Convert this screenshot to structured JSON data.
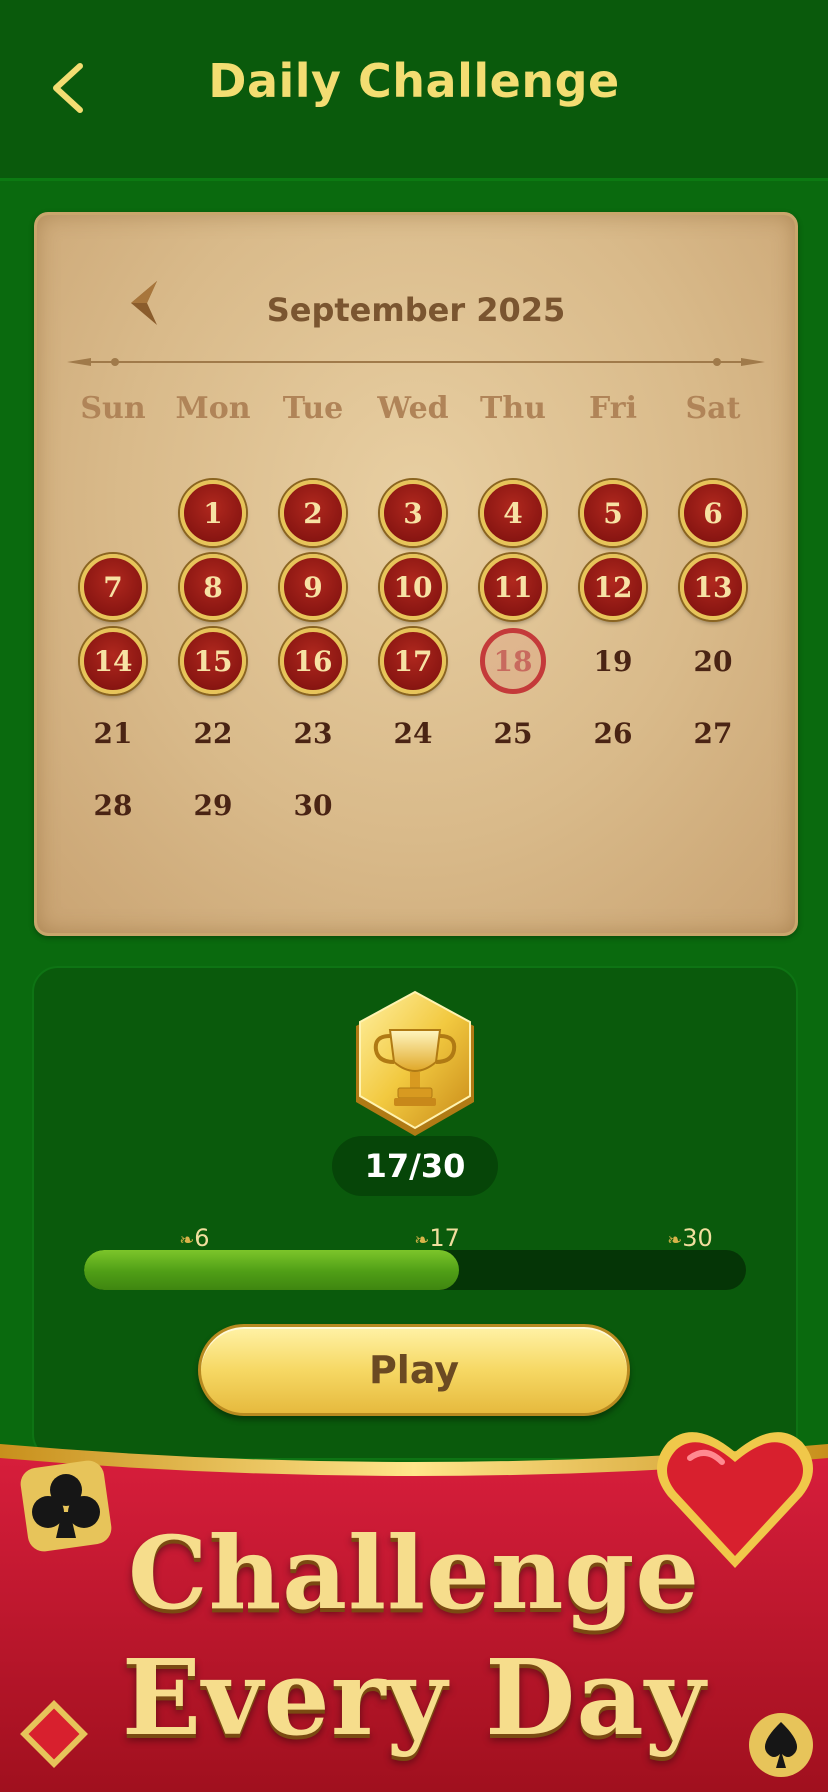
{
  "header": {
    "title": "Daily Challenge",
    "back_icon": "chevron-left-icon"
  },
  "calendar": {
    "month": "September 2025",
    "prev_icon": "arrow-left-icon",
    "weekdays": [
      "Sun",
      "Mon",
      "Tue",
      "Wed",
      "Thu",
      "Fri",
      "Sat"
    ],
    "first_weekday_index": 1,
    "days_in_month": 30,
    "completed_through": 17,
    "today": 18
  },
  "progress": {
    "trophy_icon": "trophy-icon",
    "completed": 17,
    "total": 30,
    "count_text": "17/30",
    "milestones": [
      "6",
      "17",
      "30"
    ],
    "play_label": "Play"
  },
  "banner": {
    "line1": "Challenge",
    "line2": "Every Day"
  },
  "colors": {
    "background_green": "#0a6a0e",
    "header_green": "#0a5a0c",
    "title_gold": "#f3dd72",
    "completed_day_red": "#8a1612",
    "progress_green": "#4f9e16",
    "banner_red": "#c81c32"
  }
}
